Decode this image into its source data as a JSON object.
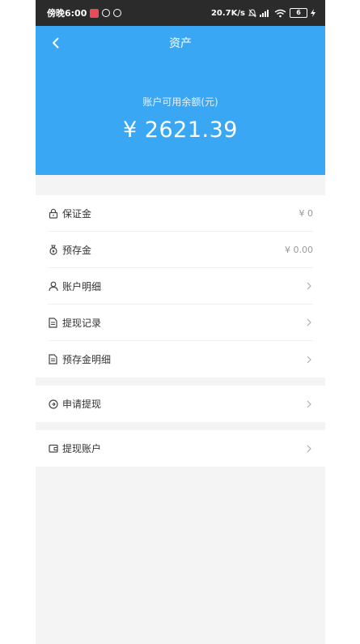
{
  "status_bar": {
    "time": "傍晚6:00",
    "net_speed": "20.7K/s",
    "battery": "6"
  },
  "header": {
    "title": "资产",
    "balance_label": "账户可用余额(元)",
    "balance_value": "¥ 2621.39"
  },
  "rows": [
    {
      "label": "保证金",
      "value": "¥ 0",
      "icon": "lock-icon"
    },
    {
      "label": "预存金",
      "value": "¥ 0.00",
      "icon": "money-bag-icon"
    },
    {
      "label": "账户明细",
      "icon": "user-icon"
    },
    {
      "label": "提现记录",
      "icon": "document-icon"
    },
    {
      "label": "预存金明细",
      "icon": "document-icon"
    },
    {
      "label": "申请提现",
      "icon": "withdraw-icon"
    },
    {
      "label": "提现账户",
      "icon": "wallet-icon"
    }
  ],
  "colors": {
    "header_bg": "#3aa7f4",
    "page_bg": "#f4f4f4",
    "status_bar_bg": "#2b2b2b"
  }
}
